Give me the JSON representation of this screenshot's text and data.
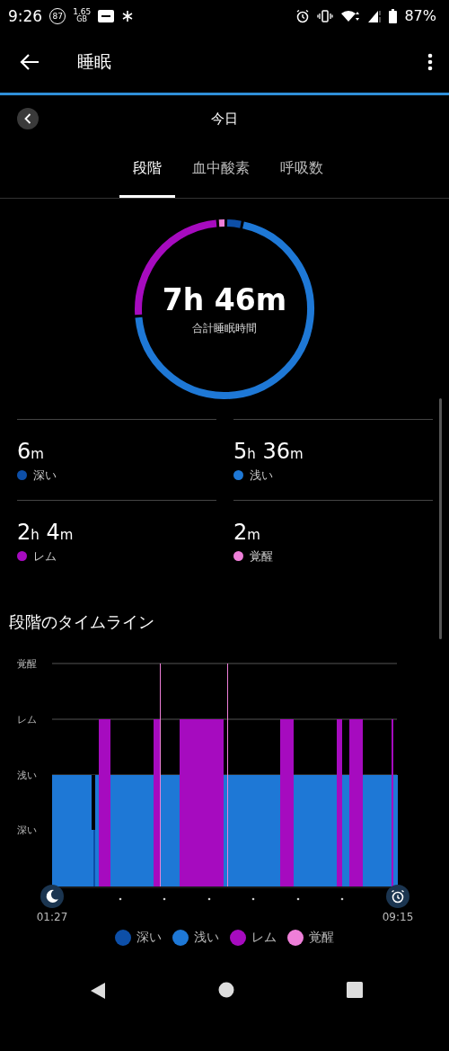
{
  "status_bar": {
    "time": "9:26",
    "badge": "87",
    "data_amount": "1.65",
    "data_unit": "GB",
    "battery": "87%"
  },
  "app_bar": {
    "title": "睡眠"
  },
  "date_nav": {
    "label": "今日"
  },
  "tabs": [
    {
      "label": "段階",
      "selected": true
    },
    {
      "label": "血中酸素",
      "selected": false
    },
    {
      "label": "呼吸数",
      "selected": false
    }
  ],
  "summary": {
    "value": "7h 46m",
    "caption": "合計睡眠時間"
  },
  "stats": [
    {
      "parts": [
        {
          "number": "6",
          "unit": "m"
        }
      ],
      "label": "深い",
      "color": "#0d4fa8"
    },
    {
      "parts": [
        {
          "number": "5",
          "unit": "h"
        },
        {
          "number": "36",
          "unit": "m"
        }
      ],
      "label": "浅い",
      "color": "#1e78d6"
    },
    {
      "parts": [
        {
          "number": "2",
          "unit": "h"
        },
        {
          "number": "4",
          "unit": "m"
        }
      ],
      "label": "レム",
      "color": "#a60bbf"
    },
    {
      "parts": [
        {
          "number": "2",
          "unit": "m"
        }
      ],
      "label": "覚醒",
      "color": "#ee7fd8"
    }
  ],
  "timeline": {
    "title": "段階のタイムライン",
    "y_labels": [
      "覚醒",
      "レム",
      "浅い",
      "深い"
    ],
    "start_time": "01:27",
    "end_time": "09:15"
  },
  "legend": [
    {
      "label": "深い",
      "color": "#0d4fa8"
    },
    {
      "label": "浅い",
      "color": "#1e78d6"
    },
    {
      "label": "レム",
      "color": "#a60bbf"
    },
    {
      "label": "覚醒",
      "color": "#ee7fd8"
    }
  ]
}
